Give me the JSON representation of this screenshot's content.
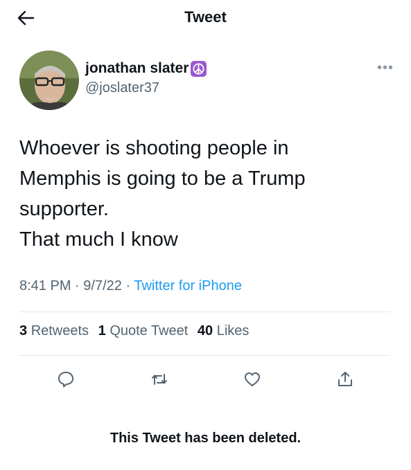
{
  "header": {
    "title": "Tweet"
  },
  "author": {
    "display_name": "jonathan slater",
    "handle": "@joslater37",
    "badge_icon": "peace-sign",
    "more_label": "•••"
  },
  "tweet": {
    "lines": [
      "Whoever is shooting people in",
      "Memphis is going to be a Trump",
      "supporter.",
      "That much I know"
    ],
    "time": "8:41 PM",
    "separator": "·",
    "date": "9/7/22",
    "source": "Twitter for iPhone"
  },
  "stats": {
    "retweets": {
      "count": "3",
      "label": "Retweets"
    },
    "quotes": {
      "count": "1",
      "label": "Quote Tweet"
    },
    "likes": {
      "count": "40",
      "label": "Likes"
    }
  },
  "actions": [
    "reply-icon",
    "retweet-icon",
    "like-icon",
    "share-icon"
  ],
  "footer": {
    "deleted_notice": "This Tweet has been deleted."
  },
  "colors": {
    "link": "#1d9bf0",
    "muted": "#536471",
    "badge": "#9b59d0"
  }
}
